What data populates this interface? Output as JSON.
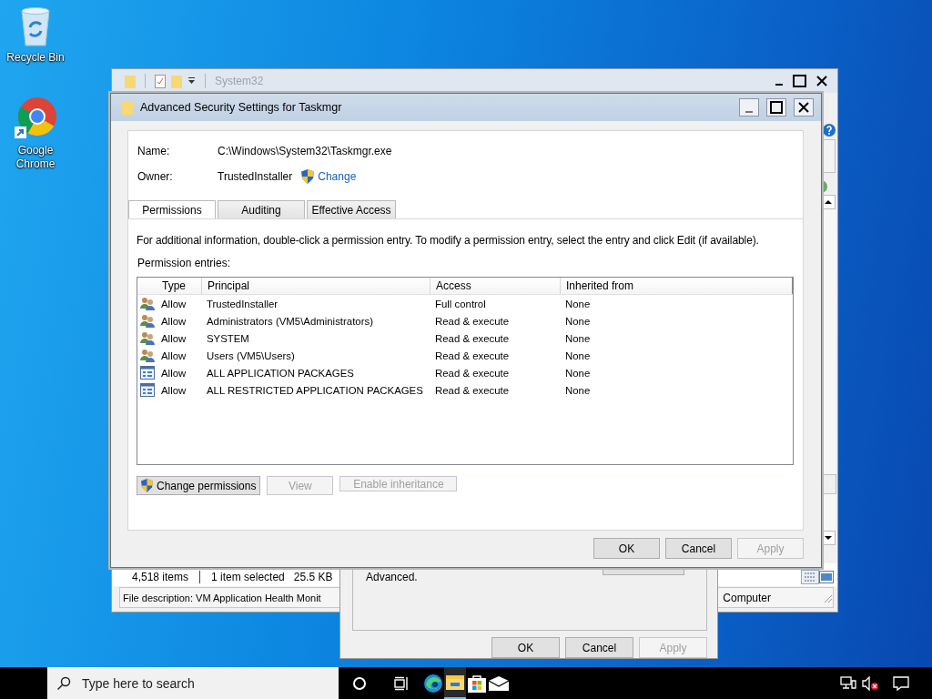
{
  "desktop_icons": [
    {
      "kind": "recycle-bin",
      "label": "Recycle Bin"
    },
    {
      "kind": "chrome",
      "label": "Google Chrome"
    }
  ],
  "explorer": {
    "title": "System32",
    "status": [
      "4,518 items",
      "1 item selected",
      "25.5 KB"
    ],
    "description": "File description: VM Application Health Monit",
    "zone": "Computer"
  },
  "properties": {
    "text": "Advanced.",
    "buttons": [
      {
        "label": "OK",
        "disabled": false
      },
      {
        "label": "Cancel",
        "disabled": false
      },
      {
        "label": "Apply",
        "disabled": true
      }
    ]
  },
  "security": {
    "title": "Advanced Security Settings for Taskmgr",
    "name_label": "Name:",
    "name": "C:\\Windows\\System32\\Taskmgr.exe",
    "owner_label": "Owner:",
    "owner": "TrustedInstaller",
    "change_link": "Change",
    "tabs": [
      {
        "label": "Permissions",
        "selected": true
      },
      {
        "label": "Auditing",
        "selected": false
      },
      {
        "label": "Effective Access",
        "selected": false
      }
    ],
    "info": "For additional information, double-click a permission entry. To modify a permission entry, select the entry and click Edit (if available).",
    "entries_label": "Permission entries:",
    "columns": [
      "Type",
      "Principal",
      "Access",
      "Inherited from"
    ],
    "rows": [
      {
        "kind": "users",
        "type": "Allow",
        "principal": "TrustedInstaller",
        "access": "Full control",
        "inherited": "None"
      },
      {
        "kind": "users",
        "type": "Allow",
        "principal": "Administrators (VM5\\Administrators)",
        "access": "Read & execute",
        "inherited": "None"
      },
      {
        "kind": "users",
        "type": "Allow",
        "principal": "SYSTEM",
        "access": "Read & execute",
        "inherited": "None"
      },
      {
        "kind": "users",
        "type": "Allow",
        "principal": "Users (VM5\\Users)",
        "access": "Read & execute",
        "inherited": "None"
      },
      {
        "kind": "package",
        "type": "Allow",
        "principal": "ALL APPLICATION PACKAGES",
        "access": "Read & execute",
        "inherited": "None"
      },
      {
        "kind": "package",
        "type": "Allow",
        "principal": "ALL RESTRICTED APPLICATION PACKAGES",
        "access": "Read & execute",
        "inherited": "None"
      }
    ],
    "action_buttons": [
      {
        "label": "Change permissions",
        "shield": true,
        "disabled": false
      },
      {
        "label": "View",
        "shield": false,
        "disabled": true
      },
      {
        "label": "Enable inheritance",
        "shield": false,
        "disabled": true
      }
    ],
    "buttons": [
      {
        "label": "OK",
        "disabled": false
      },
      {
        "label": "Cancel",
        "disabled": false
      },
      {
        "label": "Apply",
        "disabled": true
      }
    ]
  },
  "taskbar": {
    "search_placeholder": "Type here to search",
    "apps": [
      {
        "kind": "edge",
        "selected": false
      },
      {
        "kind": "explorer",
        "selected": true
      },
      {
        "kind": "store",
        "selected": false
      },
      {
        "kind": "mail",
        "selected": false
      }
    ]
  }
}
